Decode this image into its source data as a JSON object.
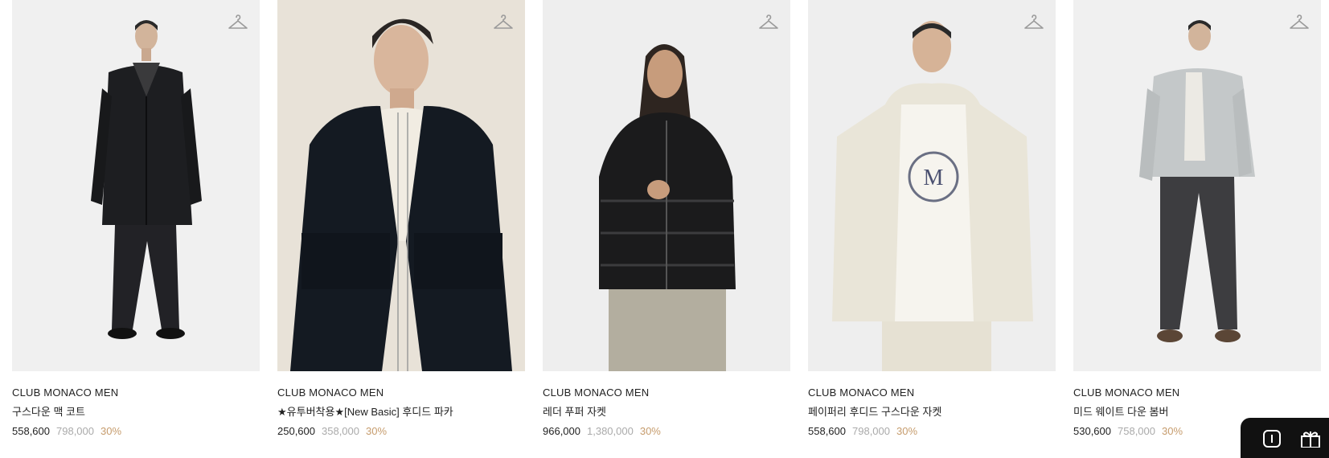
{
  "colors": {
    "price": "#222222",
    "original_price": "#aaaaaa",
    "discount": "#c69c6d",
    "floating_button_bg": "#111111"
  },
  "products": [
    {
      "brand": "CLUB MONACO MEN",
      "name": "구스다운 맥 코트",
      "price": "558,600",
      "original_price": "798,000",
      "discount": "30%",
      "image_icon": "product-photo-black-mac-coat",
      "wishlist_icon": "hanger-icon"
    },
    {
      "brand": "CLUB MONACO MEN",
      "name": "★유투버착용★[New Basic] 후디드 파카",
      "price": "250,600",
      "original_price": "358,000",
      "discount": "30%",
      "image_icon": "product-photo-navy-hooded-parka",
      "wishlist_icon": "hanger-icon"
    },
    {
      "brand": "CLUB MONACO MEN",
      "name": "레더 푸퍼 자켓",
      "price": "966,000",
      "original_price": "1,380,000",
      "discount": "30%",
      "image_icon": "product-photo-black-leather-puffer",
      "wishlist_icon": "hanger-icon"
    },
    {
      "brand": "CLUB MONACO MEN",
      "name": "페이퍼리 후디드 구스다운 자켓",
      "price": "558,600",
      "original_price": "798,000",
      "discount": "30%",
      "image_icon": "product-photo-cream-hooded-down",
      "wishlist_icon": "hanger-icon"
    },
    {
      "brand": "CLUB MONACO MEN",
      "name": "미드 웨이트 다운 봄버",
      "price": "530,600",
      "original_price": "758,000",
      "discount": "30%",
      "image_icon": "product-photo-grey-down-bomber",
      "wishlist_icon": "hanger-icon"
    }
  ],
  "floating_toolbar": {
    "icons": [
      "add-icon",
      "gift-icon"
    ]
  }
}
